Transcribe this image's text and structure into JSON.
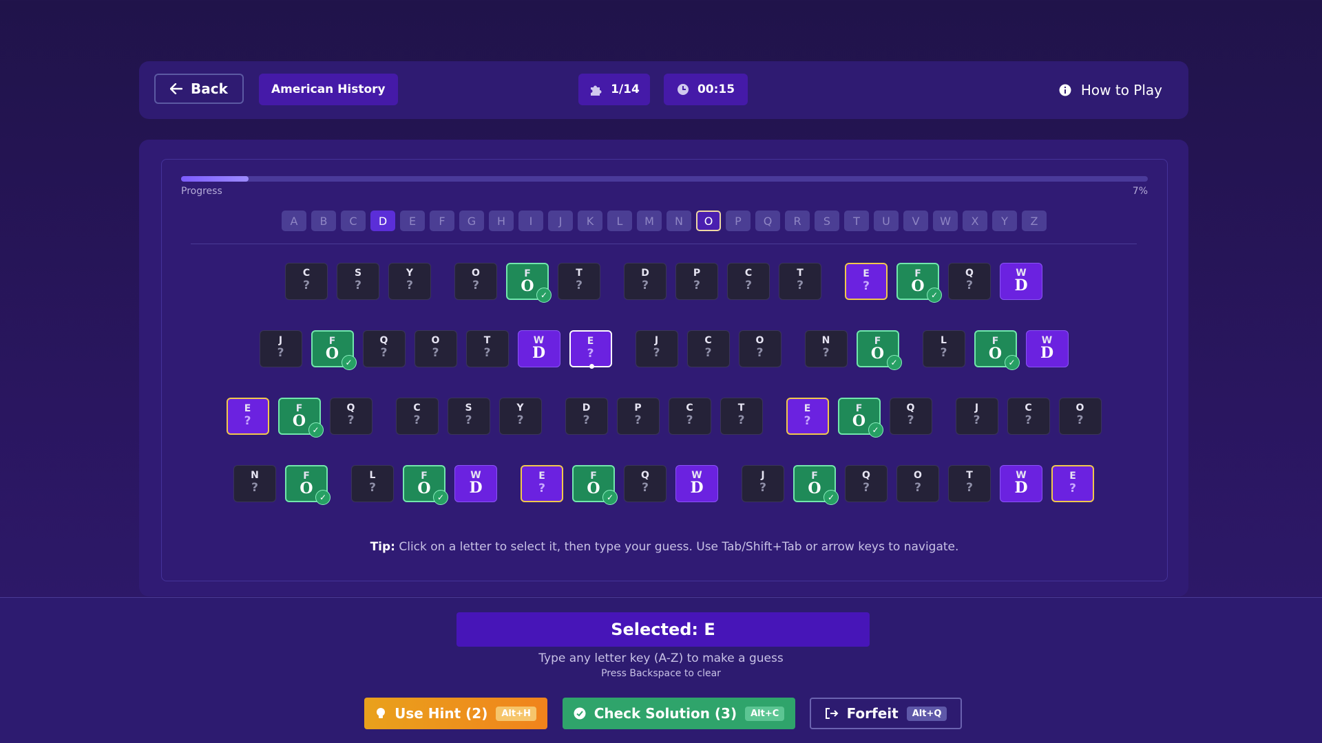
{
  "header": {
    "back_label": "Back",
    "category": "American History",
    "puzzle_counter": "1/14",
    "timer": "00:15",
    "how_to_play": "How to Play"
  },
  "progress": {
    "label": "Progress",
    "percent_text": "7%",
    "fraction": 0.07
  },
  "alphabet": {
    "letters": [
      "A",
      "B",
      "C",
      "D",
      "E",
      "F",
      "G",
      "H",
      "I",
      "J",
      "K",
      "L",
      "M",
      "N",
      "O",
      "P",
      "Q",
      "R",
      "S",
      "T",
      "U",
      "V",
      "W",
      "X",
      "Y",
      "Z"
    ],
    "used": [
      "D"
    ],
    "current": "O"
  },
  "puzzle": {
    "rows": [
      [
        [
          {
            "e": "C",
            "g": "?"
          },
          {
            "e": "S",
            "g": "?"
          },
          {
            "e": "Y",
            "g": "?"
          }
        ],
        [
          {
            "e": "O",
            "g": "?"
          },
          {
            "e": "F",
            "g": "O",
            "s": "solved"
          },
          {
            "e": "T",
            "g": "?"
          }
        ],
        [
          {
            "e": "D",
            "g": "?"
          },
          {
            "e": "P",
            "g": "?"
          },
          {
            "e": "C",
            "g": "?"
          },
          {
            "e": "T",
            "g": "?"
          }
        ],
        [
          {
            "e": "E",
            "g": "?",
            "s": "same"
          },
          {
            "e": "F",
            "g": "O",
            "s": "solved"
          },
          {
            "e": "Q",
            "g": "?"
          },
          {
            "e": "W",
            "g": "D",
            "s": "filled"
          }
        ]
      ],
      [
        [
          {
            "e": "J",
            "g": "?"
          },
          {
            "e": "F",
            "g": "O",
            "s": "solved"
          },
          {
            "e": "Q",
            "g": "?"
          },
          {
            "e": "O",
            "g": "?"
          },
          {
            "e": "T",
            "g": "?"
          },
          {
            "e": "W",
            "g": "D",
            "s": "filled"
          },
          {
            "e": "E",
            "g": "?",
            "s": "selected"
          }
        ],
        [
          {
            "e": "J",
            "g": "?"
          },
          {
            "e": "C",
            "g": "?"
          },
          {
            "e": "O",
            "g": "?"
          }
        ],
        [
          {
            "e": "N",
            "g": "?"
          },
          {
            "e": "F",
            "g": "O",
            "s": "solved"
          }
        ],
        [
          {
            "e": "L",
            "g": "?"
          },
          {
            "e": "F",
            "g": "O",
            "s": "solved"
          },
          {
            "e": "W",
            "g": "D",
            "s": "filled"
          }
        ]
      ],
      [
        [
          {
            "e": "E",
            "g": "?",
            "s": "same"
          },
          {
            "e": "F",
            "g": "O",
            "s": "solved"
          },
          {
            "e": "Q",
            "g": "?"
          }
        ],
        [
          {
            "e": "C",
            "g": "?"
          },
          {
            "e": "S",
            "g": "?"
          },
          {
            "e": "Y",
            "g": "?"
          }
        ],
        [
          {
            "e": "D",
            "g": "?"
          },
          {
            "e": "P",
            "g": "?"
          },
          {
            "e": "C",
            "g": "?"
          },
          {
            "e": "T",
            "g": "?"
          }
        ],
        [
          {
            "e": "E",
            "g": "?",
            "s": "same"
          },
          {
            "e": "F",
            "g": "O",
            "s": "solved"
          },
          {
            "e": "Q",
            "g": "?"
          }
        ],
        [
          {
            "e": "J",
            "g": "?"
          },
          {
            "e": "C",
            "g": "?"
          },
          {
            "e": "O",
            "g": "?"
          }
        ]
      ],
      [
        [
          {
            "e": "N",
            "g": "?"
          },
          {
            "e": "F",
            "g": "O",
            "s": "solved"
          }
        ],
        [
          {
            "e": "L",
            "g": "?"
          },
          {
            "e": "F",
            "g": "O",
            "s": "solved"
          },
          {
            "e": "W",
            "g": "D",
            "s": "filled"
          }
        ],
        [
          {
            "e": "E",
            "g": "?",
            "s": "same"
          },
          {
            "e": "F",
            "g": "O",
            "s": "solved"
          },
          {
            "e": "Q",
            "g": "?"
          },
          {
            "e": "W",
            "g": "D",
            "s": "filled"
          }
        ],
        [
          {
            "e": "J",
            "g": "?"
          },
          {
            "e": "F",
            "g": "O",
            "s": "solved"
          },
          {
            "e": "Q",
            "g": "?"
          },
          {
            "e": "O",
            "g": "?"
          },
          {
            "e": "T",
            "g": "?"
          },
          {
            "e": "W",
            "g": "D",
            "s": "filled"
          },
          {
            "e": "E",
            "g": "?",
            "s": "same"
          }
        ]
      ]
    ],
    "tip_bold": "Tip:",
    "tip_text": " Click on a letter to select it, then type your guess. Use Tab/Shift+Tab or arrow keys to navigate."
  },
  "footer": {
    "selected_text": "Selected: E",
    "instruction": "Type any letter key (A-Z) to make a guess",
    "sub_instruction": "Press Backspace to clear",
    "hint_label": "Use Hint (2)",
    "hint_shortcut": "Alt+H",
    "check_label": "Check Solution (3)",
    "check_shortcut": "Alt+C",
    "forfeit_label": "Forfeit",
    "forfeit_shortcut": "Alt+Q"
  },
  "icons": {
    "back": "arrow-left-icon",
    "puzzle": "puzzle-icon",
    "timer": "clock-icon",
    "info": "info-icon",
    "hint": "lightbulb-icon",
    "check": "check-circle-icon",
    "forfeit": "logout-icon",
    "solved": "check-icon"
  },
  "colors": {
    "accent": "#6b22e0",
    "solved": "#1f8a58",
    "same_letter_border": "#f2c94c",
    "hint_button": "#e9a11c",
    "check_button": "#2fa46b"
  }
}
